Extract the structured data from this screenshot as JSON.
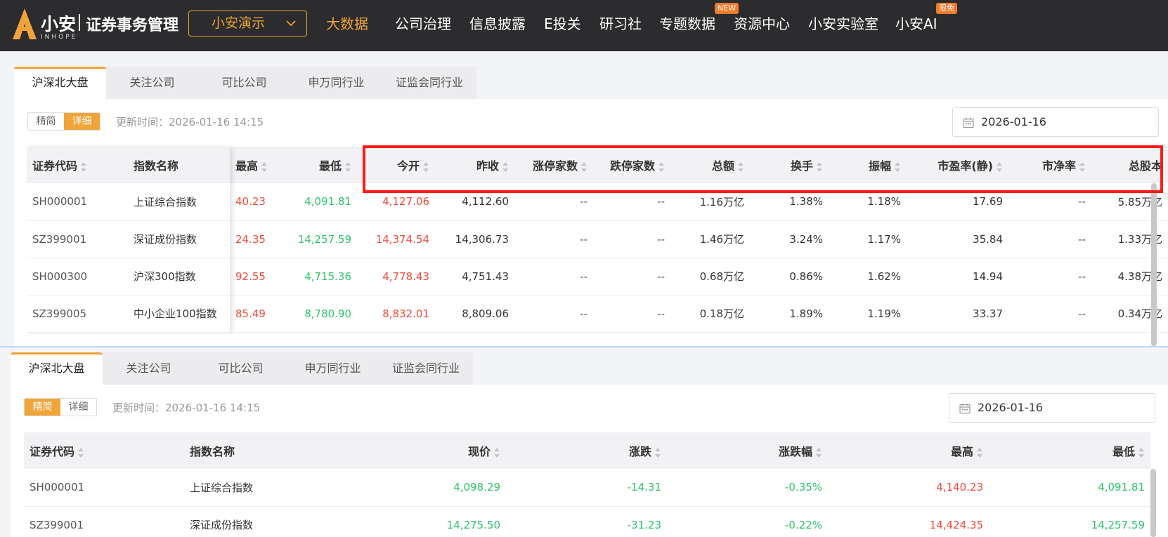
{
  "brand": {
    "name": "小安",
    "sub": "INHOPE",
    "title": "证券事务管理"
  },
  "company_select": {
    "value": "小安演示"
  },
  "nav": [
    {
      "label": "大数据",
      "active": true
    },
    {
      "label": "公司治理"
    },
    {
      "label": "信息披露"
    },
    {
      "label": "E投关"
    },
    {
      "label": "研习社"
    },
    {
      "label": "专题数据"
    },
    {
      "label": "资源中心",
      "badge": "NEW"
    },
    {
      "label": "小安实验室"
    },
    {
      "label": "小安AI",
      "badge": "限免"
    }
  ],
  "colors": {
    "accent": "#f0a53b",
    "up": "#f04a3a",
    "down": "#2dc46b",
    "highlight": "#ff1a1a"
  },
  "top_panel": {
    "tabs": [
      "沪深北大盘",
      "关注公司",
      "可比公司",
      "申万同行业",
      "证监会同行业"
    ],
    "view_toggle": [
      "精简",
      "详细"
    ],
    "active_view": "详细",
    "update_time": "更新时间：2026-01-16 14:15",
    "date": "2026-01-16",
    "fixed_headers": [
      "证券代码",
      "指数名称"
    ],
    "headers": [
      "最高",
      "最低",
      "今开",
      "昨收",
      "涨停家数",
      "跌停家数",
      "总额",
      "换手",
      "振幅",
      "市盈率(静)",
      "市净率",
      "总股本"
    ],
    "rows": [
      {
        "code": "SH000001",
        "name": "上证综合指数",
        "high": "40.23",
        "low": "4,091.81",
        "open": "4,127.06",
        "prev": "4,112.60",
        "limit_up": "--",
        "limit_down": "--",
        "amount": "1.16万亿",
        "turnover": "1.38%",
        "amplitude": "1.18%",
        "pe": "17.69",
        "pb": "--",
        "shares": "5.85万亿"
      },
      {
        "code": "SZ399001",
        "name": "深证成份指数",
        "high": "24.35",
        "low": "14,257.59",
        "open": "14,374.54",
        "prev": "14,306.73",
        "limit_up": "--",
        "limit_down": "--",
        "amount": "1.46万亿",
        "turnover": "3.24%",
        "amplitude": "1.17%",
        "pe": "35.84",
        "pb": "--",
        "shares": "1.33万亿"
      },
      {
        "code": "SH000300",
        "name": "沪深300指数",
        "high": "92.55",
        "low": "4,715.36",
        "open": "4,778.43",
        "prev": "4,751.43",
        "limit_up": "--",
        "limit_down": "--",
        "amount": "0.68万亿",
        "turnover": "0.86%",
        "amplitude": "1.62%",
        "pe": "14.94",
        "pb": "--",
        "shares": "4.38万亿"
      },
      {
        "code": "SZ399005",
        "name": "中小企业100指数",
        "high": "85.49",
        "low": "8,780.90",
        "open": "8,832.01",
        "prev": "8,809.06",
        "limit_up": "--",
        "limit_down": "--",
        "amount": "0.18万亿",
        "turnover": "1.89%",
        "amplitude": "1.19%",
        "pe": "33.37",
        "pb": "--",
        "shares": "0.34万亿"
      }
    ]
  },
  "bottom_panel": {
    "tabs": [
      "沪深北大盘",
      "关注公司",
      "可比公司",
      "申万同行业",
      "证监会同行业"
    ],
    "view_toggle": [
      "精简",
      "详细"
    ],
    "active_view": "精简",
    "update_time": "更新时间：2026-01-16 14:15",
    "date": "2026-01-16",
    "headers": [
      "证券代码",
      "指数名称",
      "现价",
      "涨跌",
      "涨跌幅",
      "最高",
      "最低"
    ],
    "rows": [
      {
        "code": "SH000001",
        "name": "上证综合指数",
        "price": "4,098.29",
        "change": "-14.31",
        "pct": "-0.35%",
        "high": "4,140.23",
        "low": "4,091.81"
      },
      {
        "code": "SZ399001",
        "name": "深证成份指数",
        "price": "14,275.50",
        "change": "-31.23",
        "pct": "-0.22%",
        "high": "14,424.35",
        "low": "14,257.59"
      }
    ]
  }
}
